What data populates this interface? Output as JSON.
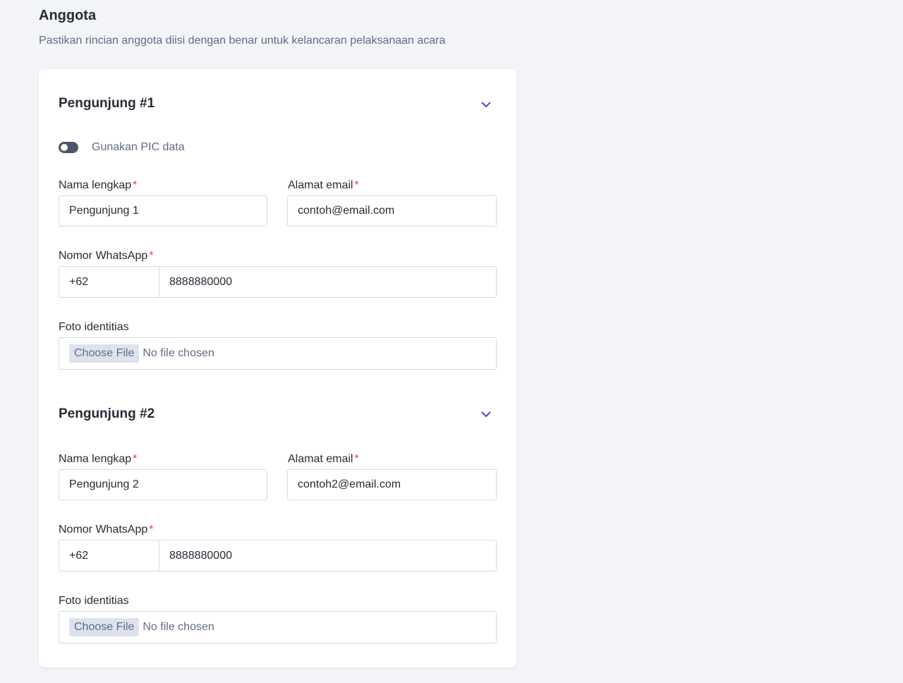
{
  "section": {
    "title": "Anggota",
    "subtitle": "Pastikan rincian anggota diisi dengan benar untuk kelancaran pelaksanaan acara"
  },
  "visitors": [
    {
      "title": "Pengunjung #1",
      "toggle_label": "Gunakan PIC data",
      "toggle_on": false,
      "name_label": "Nama lengkap",
      "name_value": "Pengunjung 1",
      "email_label": "Alamat email",
      "email_value": "contoh@email.com",
      "whatsapp_label": "Nomor WhatsApp",
      "whatsapp_code": "+62",
      "whatsapp_number": "8888880000",
      "id_photo_label": "Foto identitias",
      "file_button": "Choose File",
      "file_status": "No file chosen"
    },
    {
      "title": "Pengunjung #2",
      "name_label": "Nama lengkap",
      "name_value": "Pengunjung 2",
      "email_label": "Alamat email",
      "email_value": "contoh2@email.com",
      "whatsapp_label": "Nomor WhatsApp",
      "whatsapp_code": "+62",
      "whatsapp_number": "8888880000",
      "id_photo_label": "Foto identitias",
      "file_button": "Choose File",
      "file_status": "No file chosen"
    }
  ],
  "required_marker": "*",
  "colors": {
    "accent": "#5b3fd1",
    "required": "#e5483c",
    "toggle_off": "#4b5468",
    "muted_text": "#5f6b85"
  },
  "icons": {
    "collapse": "chevron-down-icon"
  }
}
